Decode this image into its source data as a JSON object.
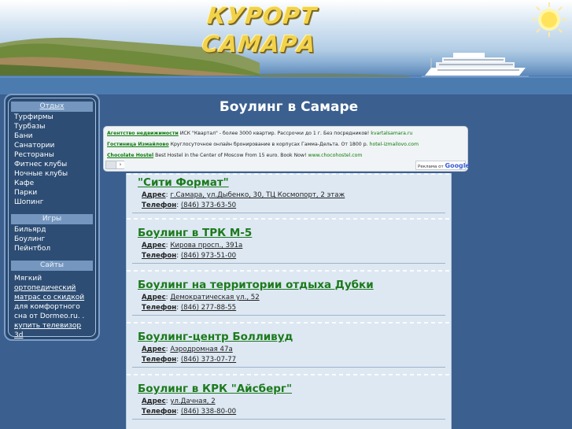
{
  "header": {
    "logo_text": "КУРОРТ САМАРА"
  },
  "sidebar": {
    "sections": [
      {
        "heading": "Отдых",
        "items": [
          "Турфирмы",
          "Турбазы",
          "Бани",
          "Санатории",
          "Рестораны",
          "Фитнес клубы",
          "Ночные клубы",
          "Кафе",
          "Парки",
          "Шопинг"
        ]
      },
      {
        "heading": "Игры",
        "items": [
          "Бильярд",
          "Боулинг",
          "Пейнтбол"
        ]
      },
      {
        "heading": "Сайты",
        "text_before": "Мягкий ",
        "link_1": "ортопедический матрас со скидкой",
        "text_middle": " для комфортного сна от Dormeo.ru. . ",
        "link_2": "купить телевизор 3d"
      }
    ]
  },
  "page": {
    "title": "Боулинг в Самаре"
  },
  "ads": {
    "items": [
      {
        "title": "Агентство недвижимости",
        "text": "ИСК \"Квартал\" - более 3000 квартир. Рассрочки до 1 г. Без посредников!",
        "url": "kvartalsamara.ru"
      },
      {
        "title": "Гостиница Измайлово",
        "text": "Круглосуточное онлайн бронирование в корпусах Гамма-Дельта. От 1800 р.",
        "url": "hotel-izmailovo.com"
      },
      {
        "title": "Chocolate Hostel",
        "text": "Best Hostel in the Center of Moscow From 15 euro. Book Now!",
        "url": "www.chocohostel.com"
      }
    ],
    "nav_next": "›",
    "badge_prefix": "Реклама от ",
    "badge_brand": "Google"
  },
  "listings": [
    {
      "name": "\"Сити Формат\"",
      "address_label": "Адрес",
      "address": "г.Самара, ул.Дыбенко, 30, ТЦ Космопорт, 2 этаж",
      "phone_label": "Телефон",
      "phone": "(846) 373-63-50"
    },
    {
      "name": "Боулинг в ТРК М-5",
      "address_label": "Адрес",
      "address": "Кирова просп., 391а",
      "phone_label": "Телефон",
      "phone": "(846) 973-51-00"
    },
    {
      "name": "Боулинг на территории отдыха Дубки",
      "address_label": "Адрес",
      "address": "Демократическая ул., 52",
      "phone_label": "Телефон",
      "phone": "(846) 277-88-55"
    },
    {
      "name": "Боулинг-центр Болливуд",
      "address_label": "Адрес",
      "address": "Аэродромная 47а",
      "phone_label": "Телефон",
      "phone": "(846) 373-07-77"
    },
    {
      "name": "Боулинг в КРК \"Айсберг\"",
      "address_label": "Адрес",
      "address": "ул.Дачная, 2",
      "phone_label": "Телефон",
      "phone": "(846) 338-80-00"
    }
  ]
}
